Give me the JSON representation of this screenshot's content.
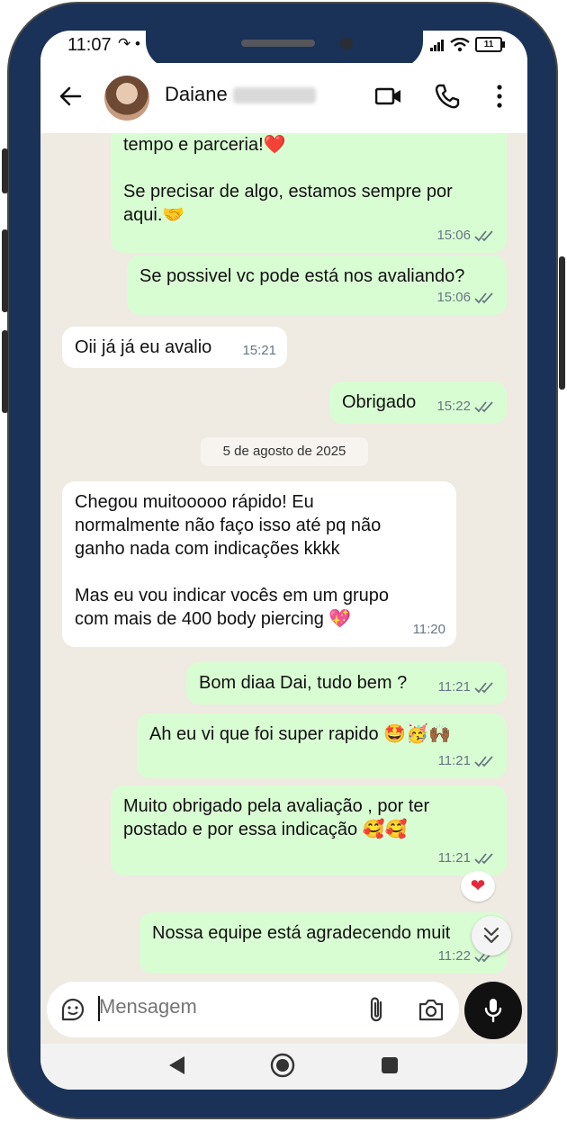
{
  "status": {
    "time": "11:07",
    "left_icons": "↷ •",
    "battery": "11"
  },
  "header": {
    "contact_name": "Daiane"
  },
  "messages": [
    {
      "dir": "out",
      "text": "tempo e parceria!❤️\n\nSe precisar de algo, estamos sempre por aqui.🤝",
      "time": "15:06"
    },
    {
      "dir": "out",
      "text": "Se possivel vc pode está nos avaliando?",
      "time": "15:06"
    },
    {
      "dir": "in",
      "text": "Oii já já eu avalio",
      "time": "15:21"
    },
    {
      "dir": "out",
      "text": "Obrigado",
      "time": "15:22"
    },
    {
      "dir": "in",
      "text": "Chegou muitooooo rápido! Eu normalmente não faço isso até pq não ganho nada com indicações kkkk\n\nMas eu vou indicar vocês em um grupo com mais de 400 body piercing 💖",
      "time": "11:20"
    },
    {
      "dir": "out",
      "text": "Bom diaa Dai, tudo bem ?",
      "time": "11:21"
    },
    {
      "dir": "out",
      "text": "Ah eu vi que foi super rapido 🤩🥳🙌🏾",
      "time": "11:21"
    },
    {
      "dir": "out",
      "text": "Muito obrigado pela avaliação , por ter postado e por essa indicação 🥰🥰",
      "time": "11:21"
    },
    {
      "dir": "out",
      "text": "Nossa equipe está agradecendo muit",
      "time": "11:22"
    }
  ],
  "date_divider": "5 de agosto de 2025",
  "reaction": "❤",
  "composer": {
    "placeholder": "Mensagem"
  },
  "colors": {
    "frame": "#1a3158",
    "out_bubble": "#d9fdd3",
    "in_bubble": "#ffffff",
    "tick": "#667781"
  }
}
